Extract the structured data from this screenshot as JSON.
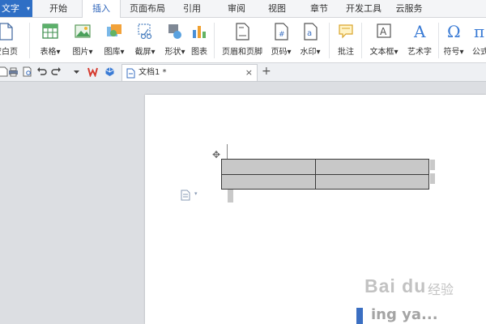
{
  "menubar": {
    "app_button": "文字",
    "tabs": [
      {
        "label": "开始",
        "active": false
      },
      {
        "label": "插入",
        "active": true
      },
      {
        "label": "页面布局",
        "active": false
      },
      {
        "label": "引用",
        "active": false
      },
      {
        "label": "审阅",
        "active": false
      },
      {
        "label": "视图",
        "active": false
      },
      {
        "label": "章节",
        "active": false
      },
      {
        "label": "开发工具",
        "active": false
      },
      {
        "label": "云服务",
        "active": false
      }
    ]
  },
  "ribbon": {
    "items": [
      {
        "label": "空白页",
        "icon": "blank-page-icon",
        "dropdown": true
      },
      {
        "label": "表格",
        "icon": "table-icon",
        "dropdown": true
      },
      {
        "label": "图片",
        "icon": "picture-icon",
        "dropdown": true
      },
      {
        "label": "图库",
        "icon": "gallery-icon",
        "dropdown": true
      },
      {
        "label": "截屏",
        "icon": "screenshot-icon",
        "dropdown": true
      },
      {
        "label": "形状",
        "icon": "shapes-icon",
        "dropdown": true
      },
      {
        "label": "图表",
        "icon": "chart-icon",
        "dropdown": false
      },
      {
        "label": "页眉和页脚",
        "icon": "header-footer-icon",
        "dropdown": false
      },
      {
        "label": "页码",
        "icon": "page-number-icon",
        "dropdown": true
      },
      {
        "label": "水印",
        "icon": "watermark-icon",
        "dropdown": true
      },
      {
        "label": "批注",
        "icon": "comment-icon",
        "dropdown": false
      },
      {
        "label": "文本框",
        "icon": "textbox-icon",
        "dropdown": true
      },
      {
        "label": "艺术字",
        "icon": "wordart-icon",
        "dropdown": false
      },
      {
        "label": "符号",
        "icon": "symbol-icon",
        "dropdown": true
      },
      {
        "label": "公式",
        "icon": "formula-icon",
        "dropdown": false
      }
    ],
    "glyphs": {
      "textbox": "A",
      "wordart": "A",
      "symbol": "Ω",
      "formula": "π",
      "page_number": "#",
      "watermark": "a"
    }
  },
  "quick_access": {
    "icons": [
      "new-doc-icon",
      "print-icon",
      "print-preview-icon",
      "undo-icon",
      "redo-icon",
      "customize-dropdown-icon"
    ]
  },
  "doc_tabs": {
    "active": {
      "title": "文档1 *"
    },
    "close_glyph": "×",
    "new_tab_glyph": "+"
  },
  "document": {
    "table": {
      "rows": 2,
      "cols": 2
    },
    "move_handle_glyph": "✥",
    "para_caret_glyph": "▾"
  },
  "watermark": {
    "logo": "Bai du",
    "text": "经验",
    "bottom": "ing ya..."
  },
  "colors": {
    "accent": "#2f6fc5",
    "active_tab_text": "#2b62b9",
    "workspace": "#dcdee2",
    "table_fill": "#c8c8c8"
  }
}
